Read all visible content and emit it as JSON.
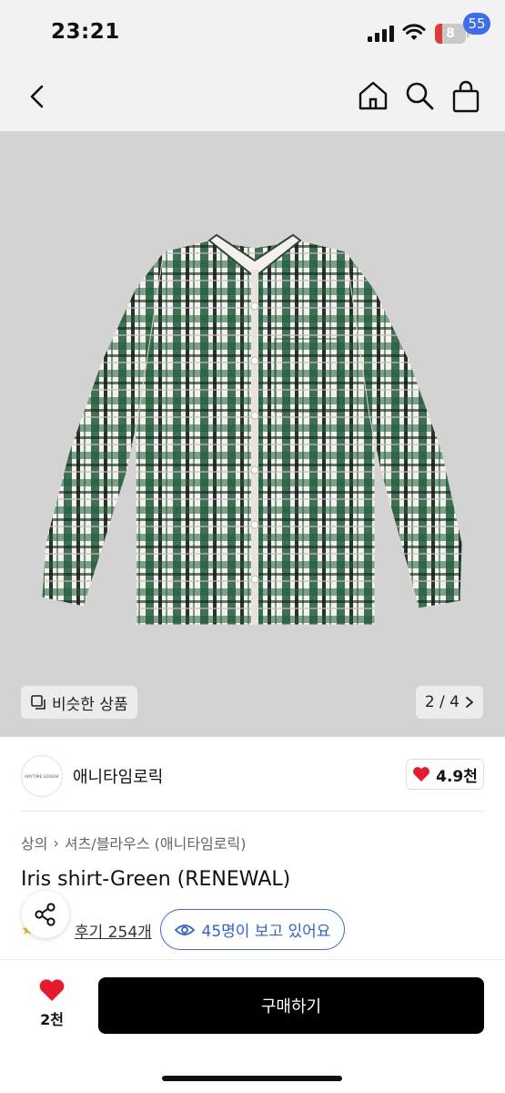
{
  "status_bar": {
    "time": "23:21",
    "battery": "8"
  },
  "nav": {
    "back_icon": "chevron-left-icon",
    "home_icon": "home-icon",
    "search_icon": "search-icon",
    "cart_icon": "shopping-bag-icon",
    "cart_badge": "55"
  },
  "gallery": {
    "similar_label": "비슷한 상품",
    "page_indicator": "2 / 4"
  },
  "seller": {
    "avatar_text": "ANYTIME LOREAK",
    "name": "애니타임로릭",
    "rating": "4.9천"
  },
  "product": {
    "breadcrumb": [
      "상의",
      "셔츠/블라우스 (애니타임로릭)"
    ],
    "title": "Iris shirt-Green (RENEWAL)",
    "reviews": "후기 254개",
    "viewers": "45명이 보고 있어요"
  },
  "bottom_bar": {
    "like_count": "2천",
    "buy_label": "구매하기"
  },
  "colors": {
    "accent": "#3d6cf0",
    "heart": "#e8192c",
    "buy_button": "#000000"
  }
}
